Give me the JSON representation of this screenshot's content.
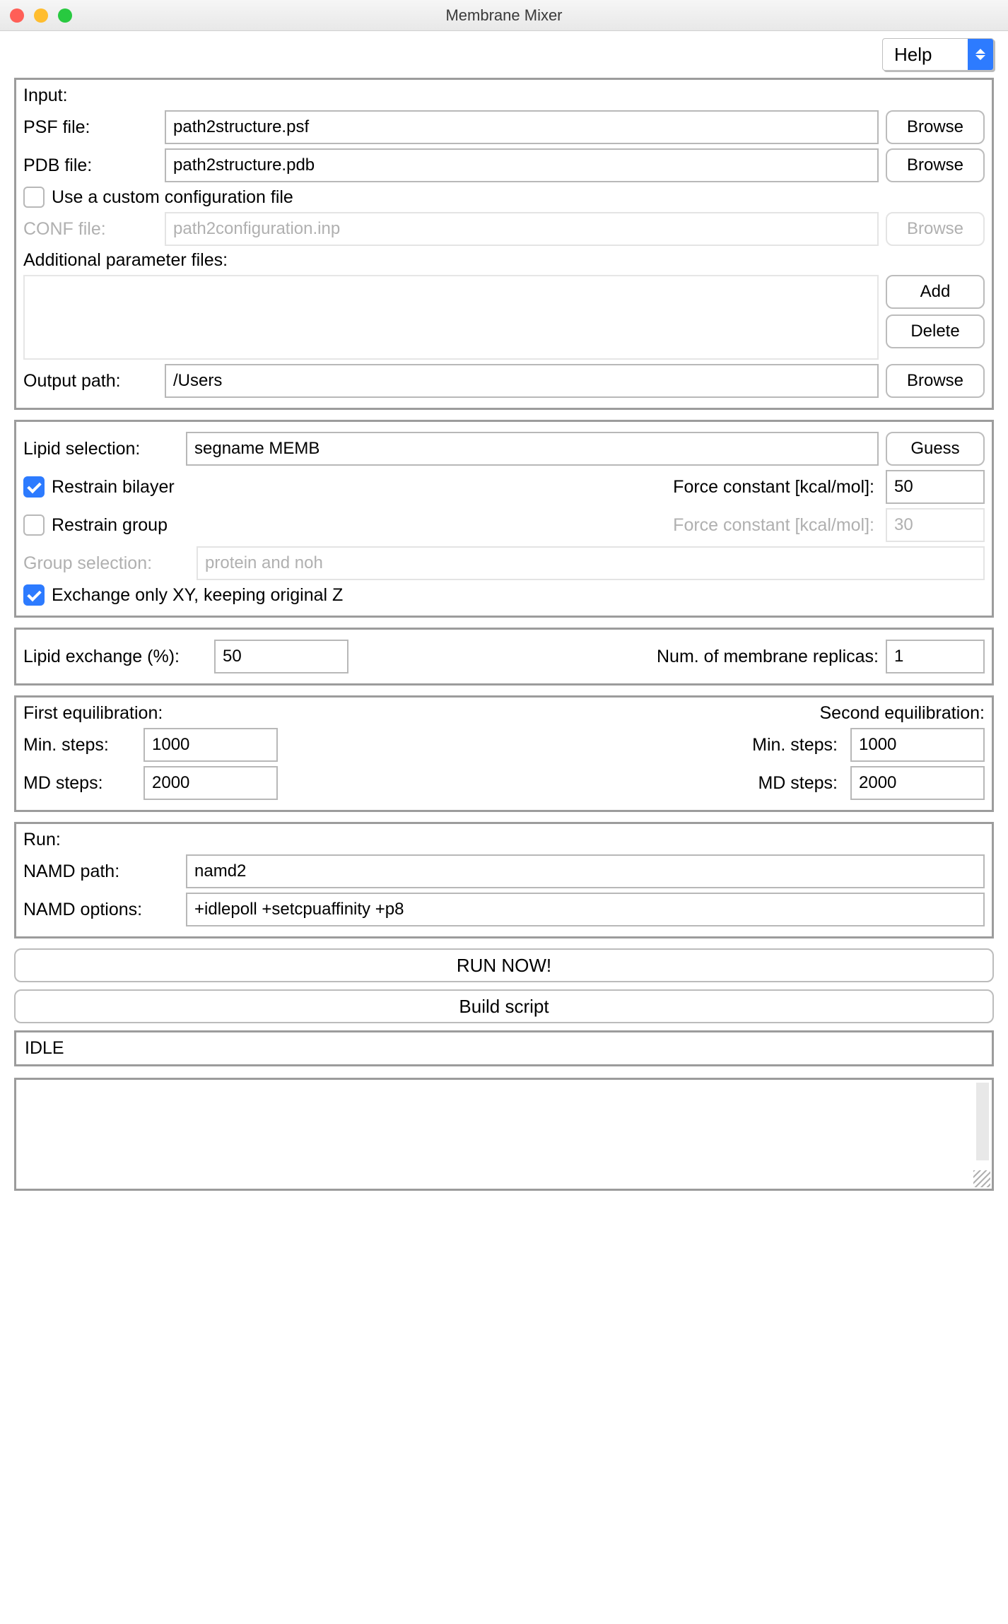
{
  "window": {
    "title": "Membrane Mixer"
  },
  "help": {
    "label": "Help"
  },
  "input": {
    "heading": "Input:",
    "psf_label": "PSF file:",
    "psf_value": "path2structure.psf",
    "pdb_label": "PDB file:",
    "pdb_value": "path2structure.pdb",
    "use_conf_label": "Use a custom configuration file",
    "use_conf_checked": false,
    "conf_label": "CONF file:",
    "conf_value": "path2configuration.inp",
    "addl_label": "Additional parameter files:",
    "outpath_label": "Output path:",
    "outpath_value": "/Users",
    "browse": "Browse",
    "add": "Add",
    "delete": "Delete"
  },
  "lipid": {
    "sel_label": "Lipid selection:",
    "sel_value": "segname MEMB",
    "guess": "Guess",
    "restrain_bilayer": "Restrain bilayer",
    "restrain_bilayer_checked": true,
    "fc_label": "Force constant [kcal/mol]:",
    "fc_bilayer_value": "50",
    "restrain_group": "Restrain group",
    "restrain_group_checked": false,
    "fc_group_value": "30",
    "group_sel_label": "Group selection:",
    "group_sel_value": "protein and noh",
    "exchange_xy": "Exchange only XY, keeping original Z",
    "exchange_xy_checked": true
  },
  "exchange": {
    "pct_label": "Lipid exchange (%):",
    "pct_value": "50",
    "rep_label": "Num. of membrane replicas:",
    "rep_value": "1"
  },
  "equil": {
    "first_label": "First equilibration:",
    "second_label": "Second equilibration:",
    "min_label": "Min. steps:",
    "md_label": "MD  steps:",
    "first_min": "1000",
    "first_md": "2000",
    "second_min": "1000",
    "second_md": "2000"
  },
  "run": {
    "heading": "Run:",
    "namd_path_label": "NAMD path:",
    "namd_path_value": "namd2",
    "namd_opts_label": "NAMD options:",
    "namd_opts_value": "+idlepoll +setcpuaffinity +p8",
    "run_now": "RUN NOW!",
    "build": "Build script"
  },
  "status": {
    "text": "IDLE"
  },
  "colors": {
    "traffic_red": "#ff5f57",
    "traffic_yellow": "#ffbd2e",
    "traffic_green": "#28c940",
    "accent_blue": "#2d7bff"
  }
}
